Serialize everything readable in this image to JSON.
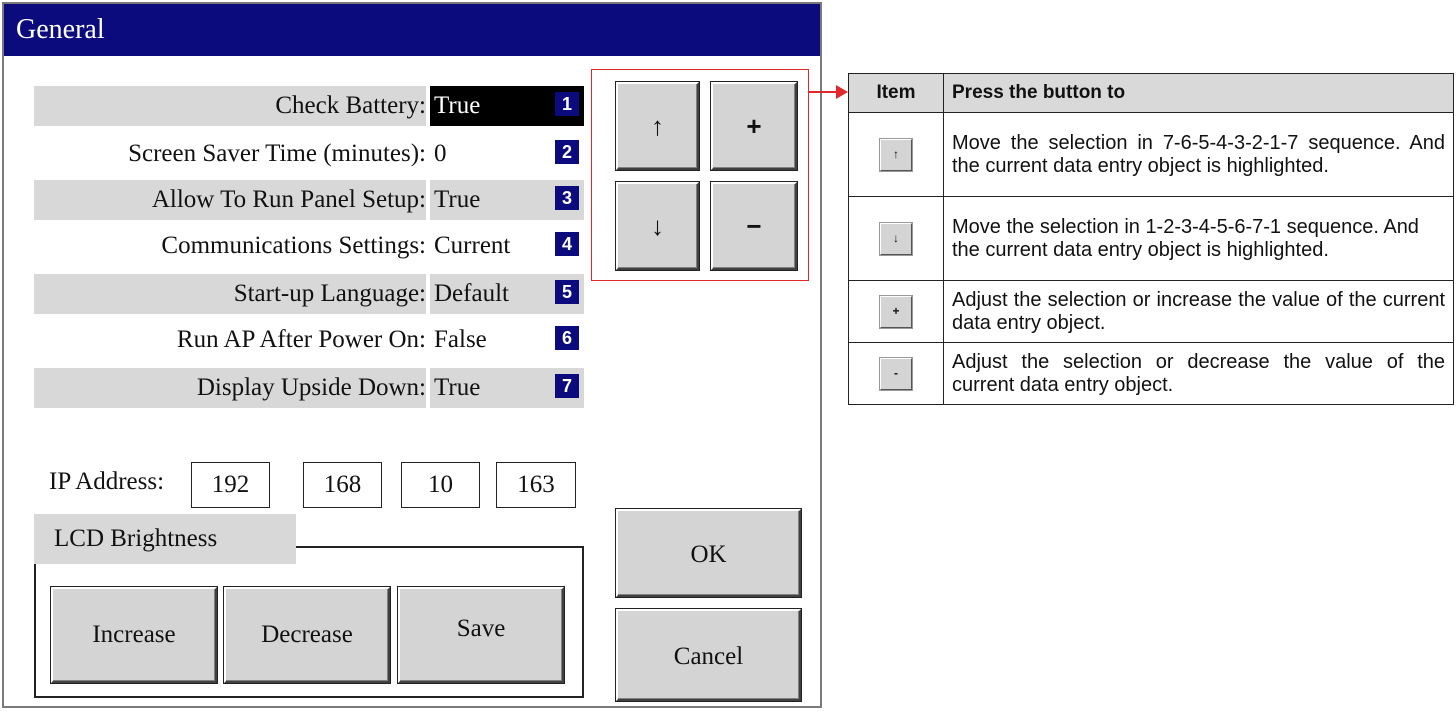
{
  "dialog": {
    "title": "General",
    "settings": [
      {
        "label": "Check Battery:",
        "value": "True",
        "index": "1",
        "shaded": true,
        "selected": true
      },
      {
        "label": "Screen Saver Time (minutes):",
        "value": "0",
        "index": "2",
        "shaded": false,
        "selected": false
      },
      {
        "label": "Allow To Run Panel Setup:",
        "value": "True",
        "index": "3",
        "shaded": true,
        "selected": false
      },
      {
        "label": "Communications Settings:",
        "value": "Current",
        "index": "4",
        "shaded": false,
        "selected": false
      },
      {
        "label": "Start-up Language:",
        "value": "Default",
        "index": "5",
        "shaded": true,
        "selected": false
      },
      {
        "label": "Run AP After Power On:",
        "value": "False",
        "index": "6",
        "shaded": false,
        "selected": false
      },
      {
        "label": "Display Upside Down:",
        "value": "True",
        "index": "7",
        "shaded": true,
        "selected": false
      }
    ],
    "ip_label": "IP Address:",
    "ip": [
      "192",
      "168",
      "10",
      "163"
    ],
    "lcd": {
      "title": "LCD Brightness",
      "increase": "Increase",
      "decrease": "Decrease",
      "save": "Save"
    },
    "nav": {
      "up": "↑",
      "plus": "+",
      "down": "↓",
      "minus": "−"
    },
    "ok": "OK",
    "cancel": "Cancel"
  },
  "help_table": {
    "col_item": "Item",
    "col_action": "Press the button to",
    "rows": [
      {
        "icon": "up-arrow-icon",
        "glyph": "↑",
        "text": "Move the selection in 7-6-5-4-3-2-1-7 sequence. And the current data entry object is highlighted."
      },
      {
        "icon": "down-arrow-icon",
        "glyph": "↓",
        "text": "Move the selection in 1-2-3-4-5-6-7-1 sequence. And the current data entry object is highlighted."
      },
      {
        "icon": "plus-icon",
        "glyph": "+",
        "text": "Adjust the selection or increase the value of the current data entry object."
      },
      {
        "icon": "minus-icon",
        "glyph": "-",
        "text": "Adjust the selection or decrease the value of the current data entry object."
      }
    ]
  },
  "colors": {
    "title_bar": "#0b0b7d",
    "highlight_frame": "#e0272b",
    "shaded_row": "#d8d8d8"
  }
}
